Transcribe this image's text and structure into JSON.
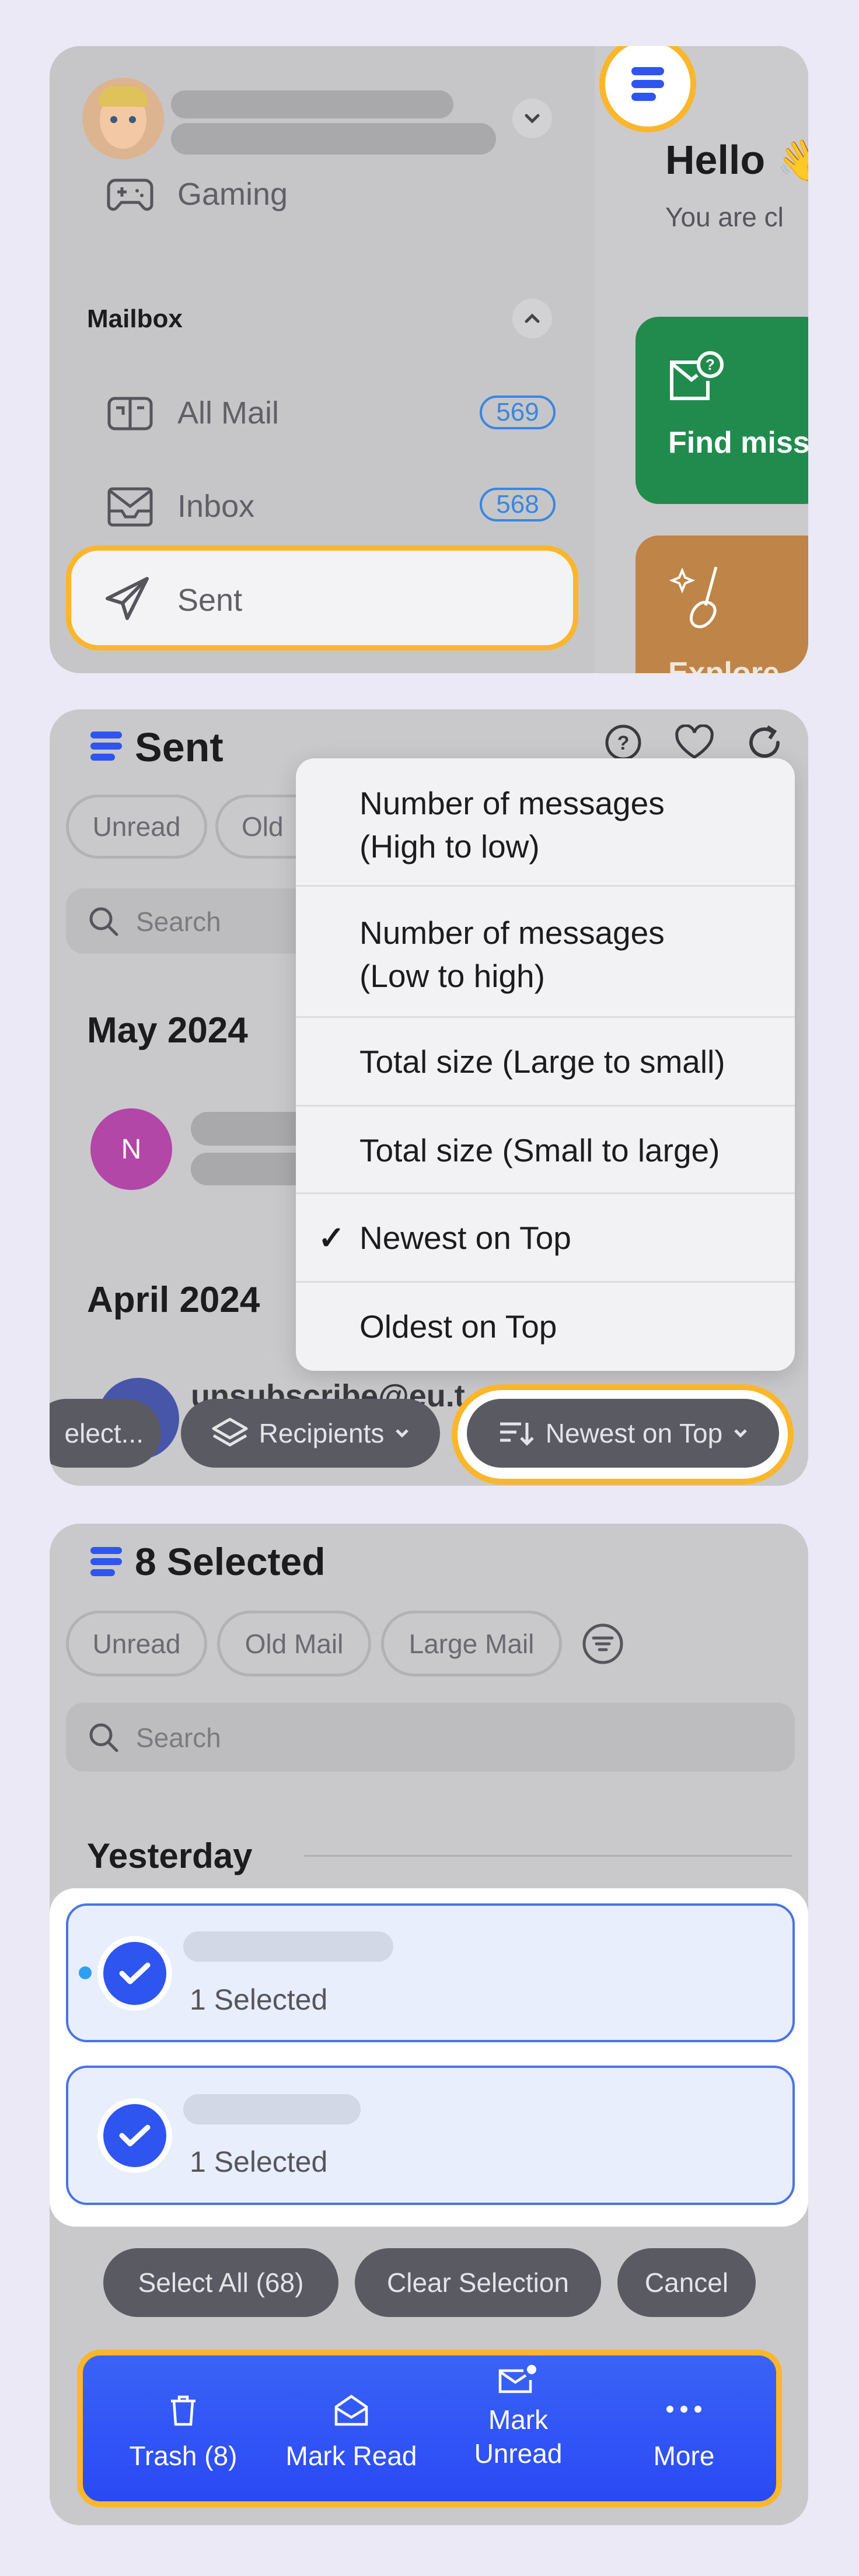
{
  "panel1": {
    "sidebar": {
      "items_top": [
        {
          "label": "Gaming",
          "icon": "gamepad-icon"
        }
      ],
      "section_title": "Mailbox",
      "items": [
        {
          "label": "All Mail",
          "icon": "all-mail-icon",
          "count": "569"
        },
        {
          "label": "Inbox",
          "icon": "inbox-icon",
          "count": "568"
        },
        {
          "label": "Sent",
          "icon": "paper-plane-icon",
          "highlighted": true
        }
      ]
    },
    "main": {
      "greeting": "Hello 👋",
      "subtitle": "You are cl",
      "cards": [
        {
          "label": "Find miss",
          "color": "#218b4e",
          "icon": "mail-question-icon"
        },
        {
          "label": "Explore",
          "color": "#bf8448",
          "icon": "sparkle-broom-icon"
        }
      ]
    }
  },
  "panel2": {
    "title": "Sent",
    "header_icons": [
      "help-icon",
      "heart-icon",
      "refresh-icon"
    ],
    "chips": [
      "Unread",
      "Old"
    ],
    "search_placeholder": "Search",
    "groups": [
      {
        "title": "May 2024",
        "avatar_letter": "N",
        "avatar_color": "#b347a8"
      },
      {
        "title": "April 2024",
        "sender": "unsubscribe@eu.t"
      }
    ],
    "sort_menu": {
      "items": [
        {
          "label": "Number of messages\n(High to low)",
          "checked": false
        },
        {
          "label": "Number of messages\n(Low to high)",
          "checked": false
        },
        {
          "label": "Total size (Large to small)",
          "checked": false
        },
        {
          "label": "Total size (Small to large)",
          "checked": false
        },
        {
          "label": "Newest on Top",
          "checked": true
        },
        {
          "label": "Oldest on Top",
          "checked": false
        }
      ],
      "check_mark": "✓"
    },
    "bottom_bar": {
      "select": "elect...",
      "recipients": "Recipients",
      "sort": "Newest on Top"
    }
  },
  "panel3": {
    "title": "8 Selected",
    "chips": [
      "Unread",
      "Old Mail",
      "Large Mail"
    ],
    "search_placeholder": "Search",
    "group_title": "Yesterday",
    "rows": [
      {
        "status": "1 Selected",
        "unread": true
      },
      {
        "status": "1 Selected",
        "unread": false
      }
    ],
    "selection_actions": [
      "Select All (68)",
      "Clear Selection",
      "Cancel"
    ],
    "toolbar": [
      {
        "label": "Trash (8)",
        "icon": "trash-icon"
      },
      {
        "label": "Mark Read",
        "icon": "envelope-open-icon"
      },
      {
        "label": "Mark\nUnread",
        "icon": "envelope-dot-icon"
      },
      {
        "label": "More",
        "icon": "more-icon"
      }
    ]
  },
  "colors": {
    "accent": "#2f55f0",
    "highlight": "#fbb62c",
    "badge": "#3a86e0"
  }
}
